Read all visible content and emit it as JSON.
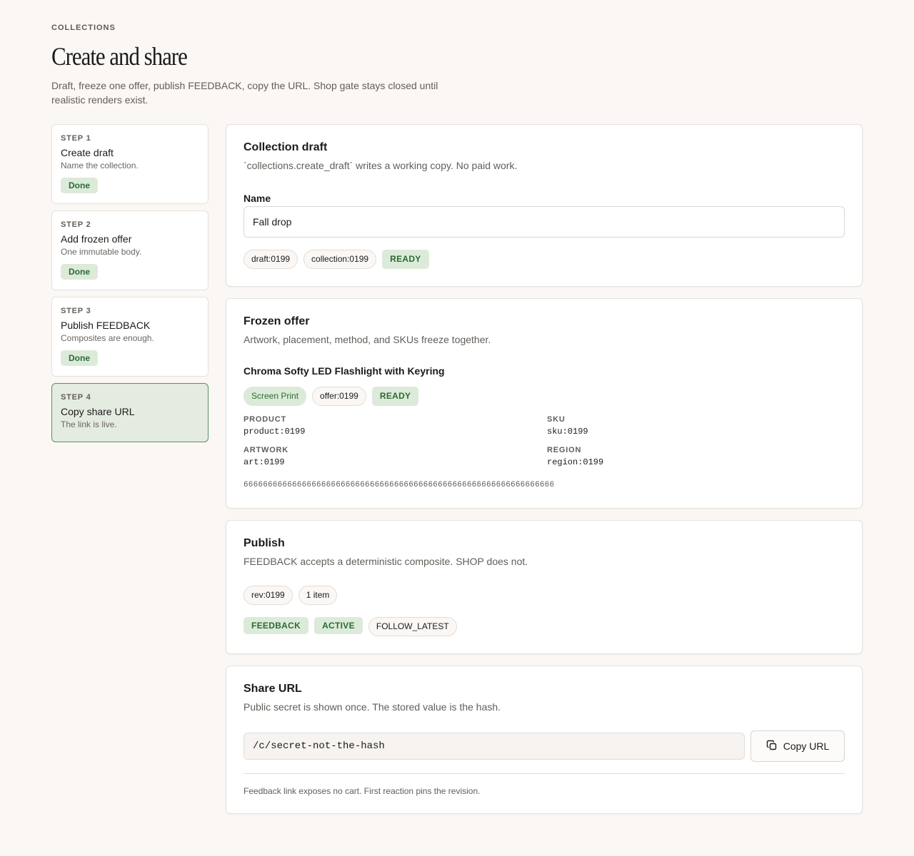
{
  "header": {
    "eyebrow": "COLLECTIONS",
    "title": "Create and share",
    "subtitle": "Draft, freeze one offer, publish FEEDBACK, copy the URL. Shop gate stays closed until realistic renders exist."
  },
  "steps": [
    {
      "kicker": "STEP 1",
      "title": "Create draft",
      "desc": "Name the collection.",
      "status": "Done"
    },
    {
      "kicker": "STEP 2",
      "title": "Add frozen offer",
      "desc": "One immutable body.",
      "status": "Done"
    },
    {
      "kicker": "STEP 3",
      "title": "Publish FEEDBACK",
      "desc": "Composites are enough.",
      "status": "Done"
    },
    {
      "kicker": "STEP 4",
      "title": "Copy share URL",
      "desc": "The link is live."
    }
  ],
  "draft": {
    "title": "Collection draft",
    "sub": "`collections.create_draft` writes a working copy. No paid work.",
    "name_label": "Name",
    "name_value": "Fall drop",
    "chips": [
      "draft:0199",
      "collection:0199"
    ],
    "status": "READY"
  },
  "offer": {
    "title": "Frozen offer",
    "sub": "Artwork, placement, method, and SKUs freeze together.",
    "product_name": "Chroma Softy LED Flashlight with Keyring",
    "method": "Screen Print",
    "offer_chip": "offer:0199",
    "status": "READY",
    "fields": {
      "product_key": "PRODUCT",
      "product_val": "product:0199",
      "sku_key": "SKU",
      "sku_val": "sku:0199",
      "artwork_key": "ARTWORK",
      "artwork_val": "art:0199",
      "region_key": "REGION",
      "region_val": "region:0199"
    },
    "hash": "6666666666666666666666666666666666666666666666666666666666666666"
  },
  "publish": {
    "title": "Publish",
    "sub": "FEEDBACK accepts a deterministic composite. SHOP does not.",
    "rev_chip": "rev:0199",
    "items_chip": "1 item",
    "channel": "FEEDBACK",
    "state": "ACTIVE",
    "policy": "FOLLOW_LATEST"
  },
  "share": {
    "title": "Share URL",
    "sub": "Public secret is shown once. The stored value is the hash.",
    "url": "/c/secret-not-the-hash",
    "copy_label": "Copy URL",
    "copy_icon": "copy-icon",
    "footnote": "Feedback link exposes no cart. First reaction pins the revision."
  },
  "colors": {
    "background": "#faf7f4",
    "accent_green": "#2c6a33",
    "green_bg": "#dcebd9",
    "active_step_bg": "#e4ebe0",
    "active_step_border": "#5c8f62"
  }
}
